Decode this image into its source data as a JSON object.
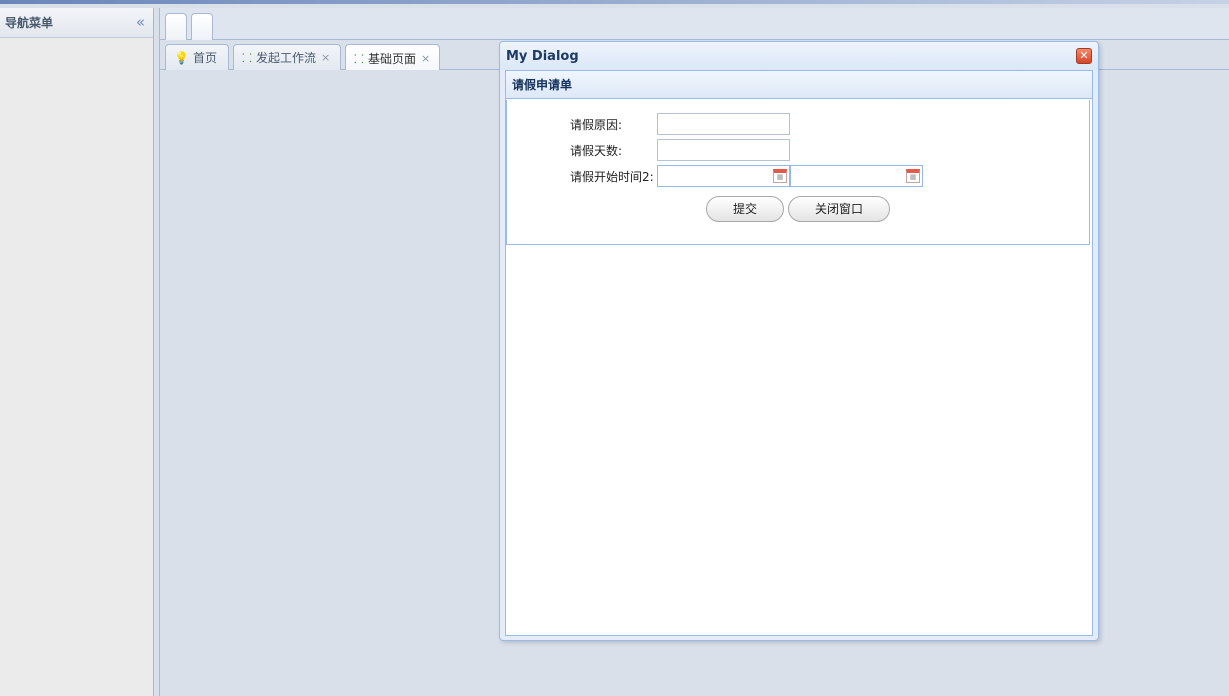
{
  "nav": {
    "title": "导航菜单",
    "collapse_icon": "double-chevron-left-icon"
  },
  "tabs": [
    {
      "label": "首页",
      "icon": "lightbulb-icon",
      "closable": false
    },
    {
      "label": "发起工作流",
      "icon": "org-tree-icon",
      "closable": true
    },
    {
      "label": "基础页面",
      "icon": "org-tree-icon",
      "closable": true,
      "active": true
    }
  ],
  "tab_close_glyph": "×",
  "dialog": {
    "title": "My Dialog",
    "close_glyph": "✕",
    "panel_title": "请假申请单",
    "fields": {
      "reason_label": "请假原因:",
      "reason_value": "",
      "days_label": "请假天数:",
      "days_value": "",
      "start_label": "请假开始时间2:",
      "start_value": "",
      "end_value": ""
    },
    "submit_label": "提交",
    "close_label": "关闭窗口"
  },
  "colors": {
    "accent": "#99bbe8",
    "title": "#1c3a66",
    "close_button": "#d8462c"
  }
}
